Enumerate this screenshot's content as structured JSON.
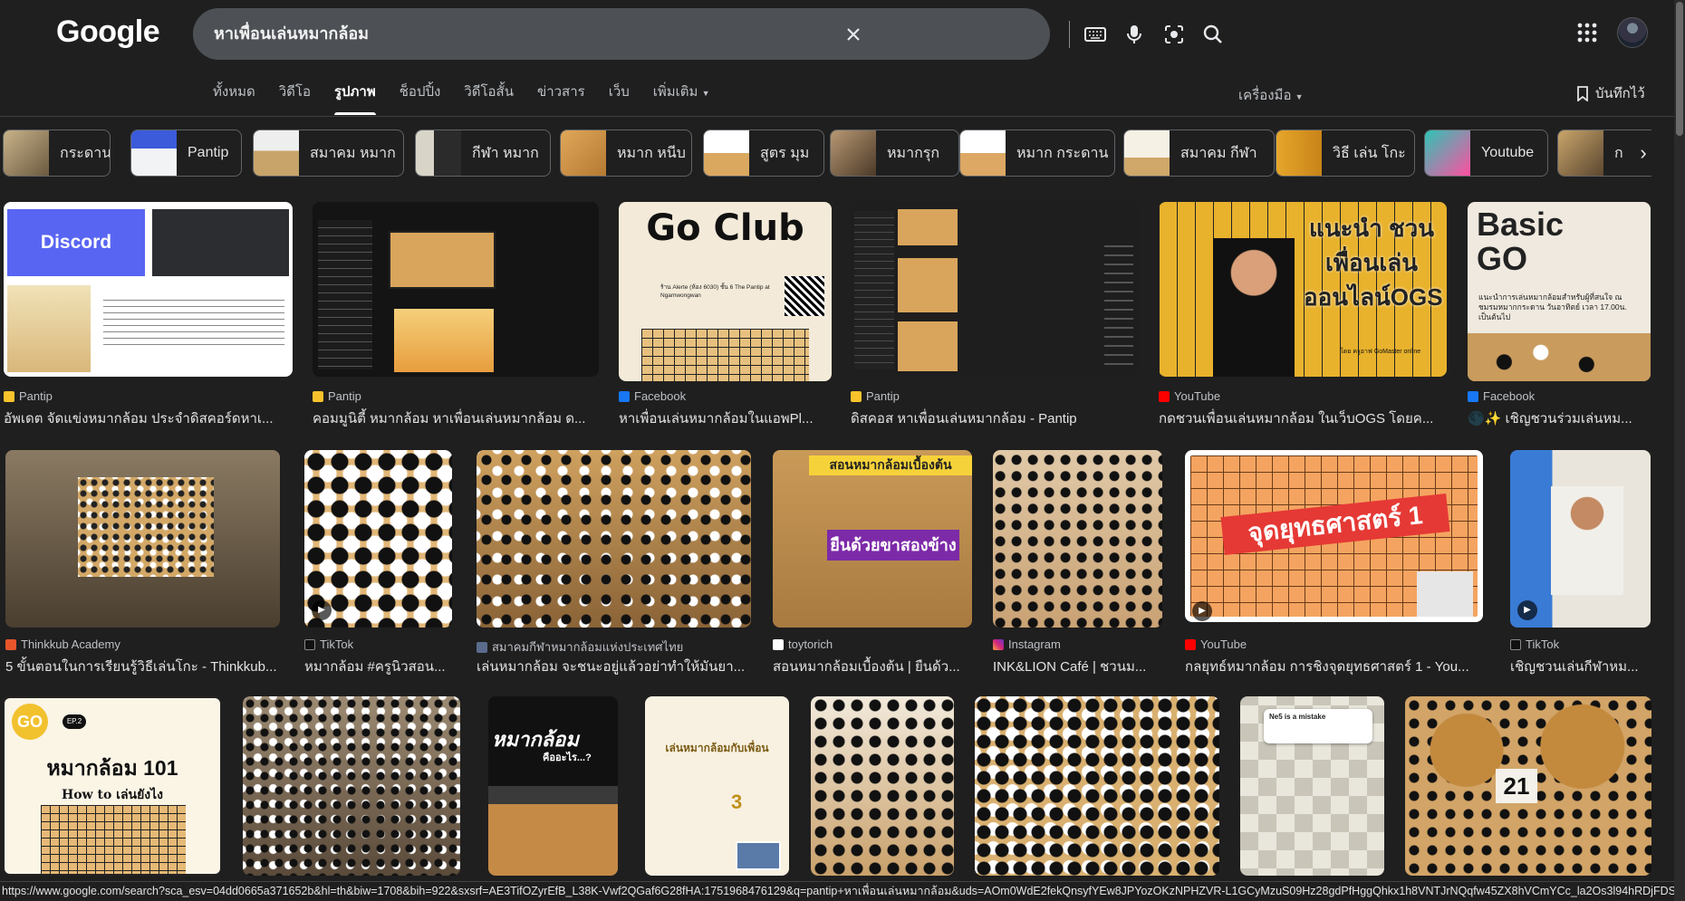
{
  "header": {
    "logo": "Google",
    "query": "หาเพื่อนเล่นหมากล้อม",
    "icons": [
      "clear-icon",
      "keyboard-icon",
      "mic-icon",
      "lens-icon",
      "search-icon",
      "apps-grid-icon"
    ]
  },
  "tabs": [
    "ทั้งหมด",
    "วิดีโอ",
    "รูปภาพ",
    "ช็อปปิ้ง",
    "วิดีโอสั้น",
    "ข่าวสาร",
    "เว็บ",
    "เพิ่มเติม"
  ],
  "tools_label": "เครื่องมือ",
  "saved_label": "บันทึกไว้",
  "chips": [
    "กระดาน",
    "Pantip",
    "สมาคม หมาก",
    "กีฬา หมาก",
    "หมาก หนีบ",
    "สูตร มุม",
    "หมากรุก",
    "หมาก กระดาน",
    "สมาคม กีฬา",
    "วิธี เล่น โกะ",
    "Youtube",
    "ก"
  ],
  "row1": [
    {
      "source": "Pantip",
      "title": "อัพเดต จัดแข่งหมากล้อม ประจำดิสคอร์ดหาเ..."
    },
    {
      "source": "Pantip",
      "title": "คอมมูนิตี้ หมากล้อม หาเพื่อนเล่นหมากล้อม ด..."
    },
    {
      "source": "Facebook",
      "title": "หาเพื่อนเล่นหมากล้อมในแอพPl..."
    },
    {
      "source": "Pantip",
      "title": "ดิสคอส หาเพื่อนเล่นหมากล้อม - Pantip"
    },
    {
      "source": "YouTube",
      "title": "กดชวนเพื่อนเล่นหมากล้อม ในเว็บOGS โดยค..."
    },
    {
      "source": "Facebook",
      "title": "🌑✨ เชิญชวนร่วมเล่นหม..."
    }
  ],
  "row2": [
    {
      "source": "Thinkkub Academy",
      "title": "5 ขั้นตอนในการเรียนรู้วิธีเล่นโกะ - Thinkkub..."
    },
    {
      "source": "TikTok",
      "title": "หมากล้อม #ครูนิวสอน..."
    },
    {
      "source": "สมาคมกีฬาหมากล้อมแห่งประเทศไทย",
      "title": "เล่นหมากล้อม จะชนะอยู่แล้วอย่าทำให้มันยา..."
    },
    {
      "source": "toytorich",
      "title": "สอนหมากล้อมเบื้องต้น | ยืนด้ว..."
    },
    {
      "source": "Instagram",
      "title": "INK&LION Café | ชวนม..."
    },
    {
      "source": "YouTube",
      "title": "กลยุทธ์หมากล้อม การชิงจุดยุทธศาสตร์ 1 - You..."
    },
    {
      "source": "TikTok",
      "title": "เชิญชวนเล่นกีฬาหม..."
    }
  ],
  "image_text": {
    "discord": "Discord",
    "goclub": "Go Club",
    "club_sub": "ร้าน Alerte (ห้อง 6030) ชั้น 6 The Pantip at Ngamwongwan",
    "ogs": "แนะนำ ชวนเพื่อนเล่น ออนไลน์OGS",
    "ogs_sub": "โดย ครูอาฟ GoMaster online",
    "basic_go": "Basic GO",
    "basic_sub": "แนะนำการเล่นหมากล้อมสำหรับผู้ที่สนใจ ณ ชมรมหมากกระดาน วันอาทิตย์ เวลา 17.00น. เป็นต้นไป",
    "stand": "ยืนด้วยขาสองข้าง",
    "stand_top": "สอนหมากล้อมเบื้องต้น",
    "strategy": "จุดยุทธศาสตร์ 1",
    "go101": "หมากล้อม 101",
    "howto": "How to เล่นยังไง",
    "go_badge": "GO",
    "ep": "EP.2",
    "whatis": "หมากล้อม",
    "whatis_sub": "คืออะไร...?",
    "poster_title": "เล่นหมากล้อมกับเพื่อน",
    "poster_count": "3",
    "mistake": "Ne5 is a mistake",
    "num21": "21"
  },
  "status_url": "https://www.google.com/search?sca_esv=04dd0665a371652b&hl=th&biw=1708&bih=922&sxsrf=AE3TifOZyrEfB_L38K-Vwf2QGaf6G28fHA:1751968476129&q=pantip+หาเพื่อนเล่นหมากล้อม&uds=AOm0WdE2fekQnsyfYEw8JPYozOKzNPHZVR-L1GCyMzuS09Hz28gdPfHggQhkx1h8VNTJrNQqfw45ZX8hVCmYCc_la2Os3l94hRDjFDSRJwxvEPKwHf_ULeb3..."
}
